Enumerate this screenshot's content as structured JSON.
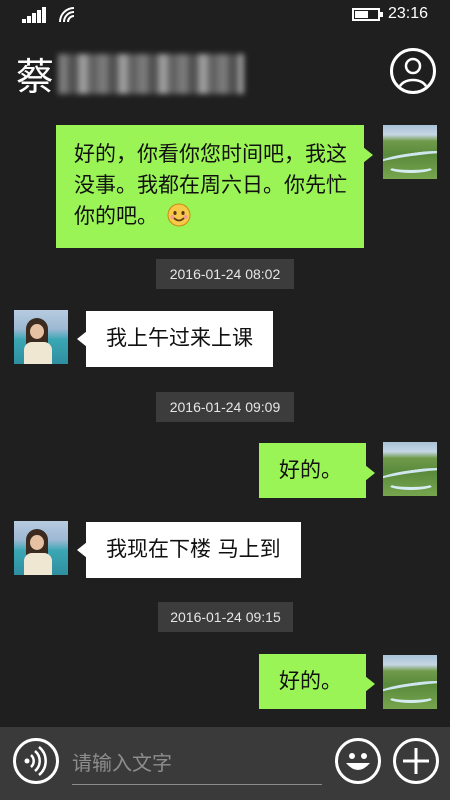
{
  "status_bar": {
    "time": "23:16",
    "battery_level": 0.6
  },
  "header": {
    "contact_name": "蔡"
  },
  "messages": [
    {
      "direction": "out",
      "text": "好的，你看你您时间吧，我这没事。我都在周六日。你先忙你的吧。",
      "emoji": "smile-emoji"
    },
    {
      "type": "timestamp",
      "text": "2016-01-24 08:02"
    },
    {
      "direction": "in",
      "text": "我上午过来上课"
    },
    {
      "type": "timestamp",
      "text": "2016-01-24 09:09"
    },
    {
      "direction": "out",
      "text": "好的。"
    },
    {
      "direction": "in",
      "text": "我现在下楼 马上到"
    },
    {
      "type": "timestamp",
      "text": "2016-01-24 09:15"
    },
    {
      "direction": "out",
      "text": "好的。"
    }
  ],
  "input": {
    "placeholder": "请输入文字",
    "value": ""
  },
  "colors": {
    "background": "#1f1f1f",
    "outgoing_bubble": "#9bf455",
    "incoming_bubble": "#ffffff",
    "timestamp_bg": "#3c3c3c",
    "bottom_bar": "#3a3a3a"
  },
  "icons": [
    "signal-icon",
    "wifi-icon",
    "battery-icon",
    "profile-icon",
    "voice-icon",
    "emoji-icon",
    "plus-icon"
  ]
}
